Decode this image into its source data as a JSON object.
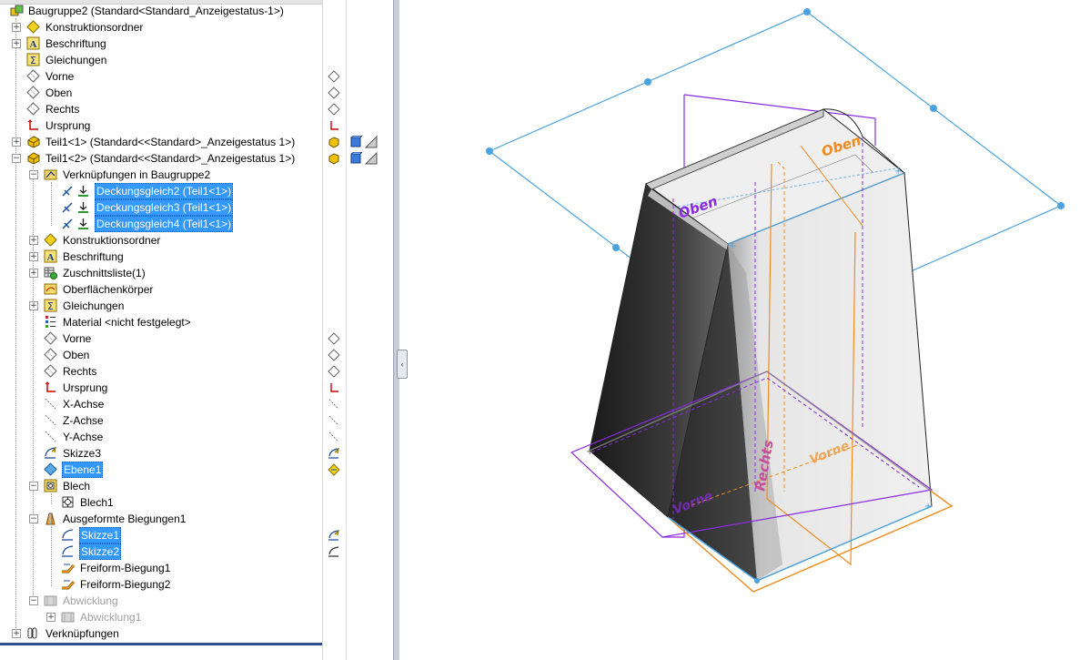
{
  "tree": {
    "root": "Baugruppe2  (Standard<Standard_Anzeigestatus-1>)",
    "konstruktionsordner": "Konstruktionsordner",
    "beschriftung": "Beschriftung",
    "gleichungen": "Gleichungen",
    "vorne": "Vorne",
    "oben": "Oben",
    "rechts": "Rechts",
    "ursprung": "Ursprung",
    "teil1_1": "Teil1<1> (Standard<<Standard>_Anzeigestatus 1>)",
    "teil1_2": "Teil1<2> (Standard<<Standard>_Anzeigestatus 1>)",
    "mates_folder": "Verknüpfungen in Baugruppe2",
    "mate1": "Deckungsgleich2 (Teil1<1>)",
    "mate2": "Deckungsgleich3 (Teil1<1>)",
    "mate3": "Deckungsgleich4 (Teil1<1>)",
    "p_konstruktionsordner": "Konstruktionsordner",
    "p_beschriftung": "Beschriftung",
    "p_zuschnittsliste": "Zuschnittsliste(1)",
    "p_oberflaechen": "Oberflächenkörper",
    "p_gleichungen": "Gleichungen",
    "p_material": "Material <nicht festgelegt>",
    "p_vorne": "Vorne",
    "p_oben": "Oben",
    "p_rechts": "Rechts",
    "p_ursprung": "Ursprung",
    "p_xachse": "X-Achse",
    "p_zachse": "Z-Achse",
    "p_yachse": "Y-Achse",
    "p_skizze3": "Skizze3",
    "p_ebene1": "Ebene1",
    "p_blech": "Blech",
    "p_blech1": "Blech1",
    "p_ausgeformt": "Ausgeformte Biegungen1",
    "p_skizze1": "Skizze1",
    "p_skizze2": "Skizze2",
    "p_freiform1": "Freiform-Biegung1",
    "p_freiform2": "Freiform-Biegung2",
    "p_abwicklung": "Abwicklung",
    "p_abwicklung1": "Abwicklung1",
    "verknuepfungen": "Verknüpfungen"
  },
  "viewport": {
    "label_oben_back": "Oben",
    "label_oben_front": "Oben",
    "label_rechts": "Rechts",
    "label_vorne": "Vorne",
    "label_vorne_bottom": "Vorne"
  },
  "colors": {
    "selection": "#3399ff",
    "plane_blue": "#4aa3e0",
    "plane_purple": "#8a2be2",
    "plane_orange": "#f08c1e"
  }
}
